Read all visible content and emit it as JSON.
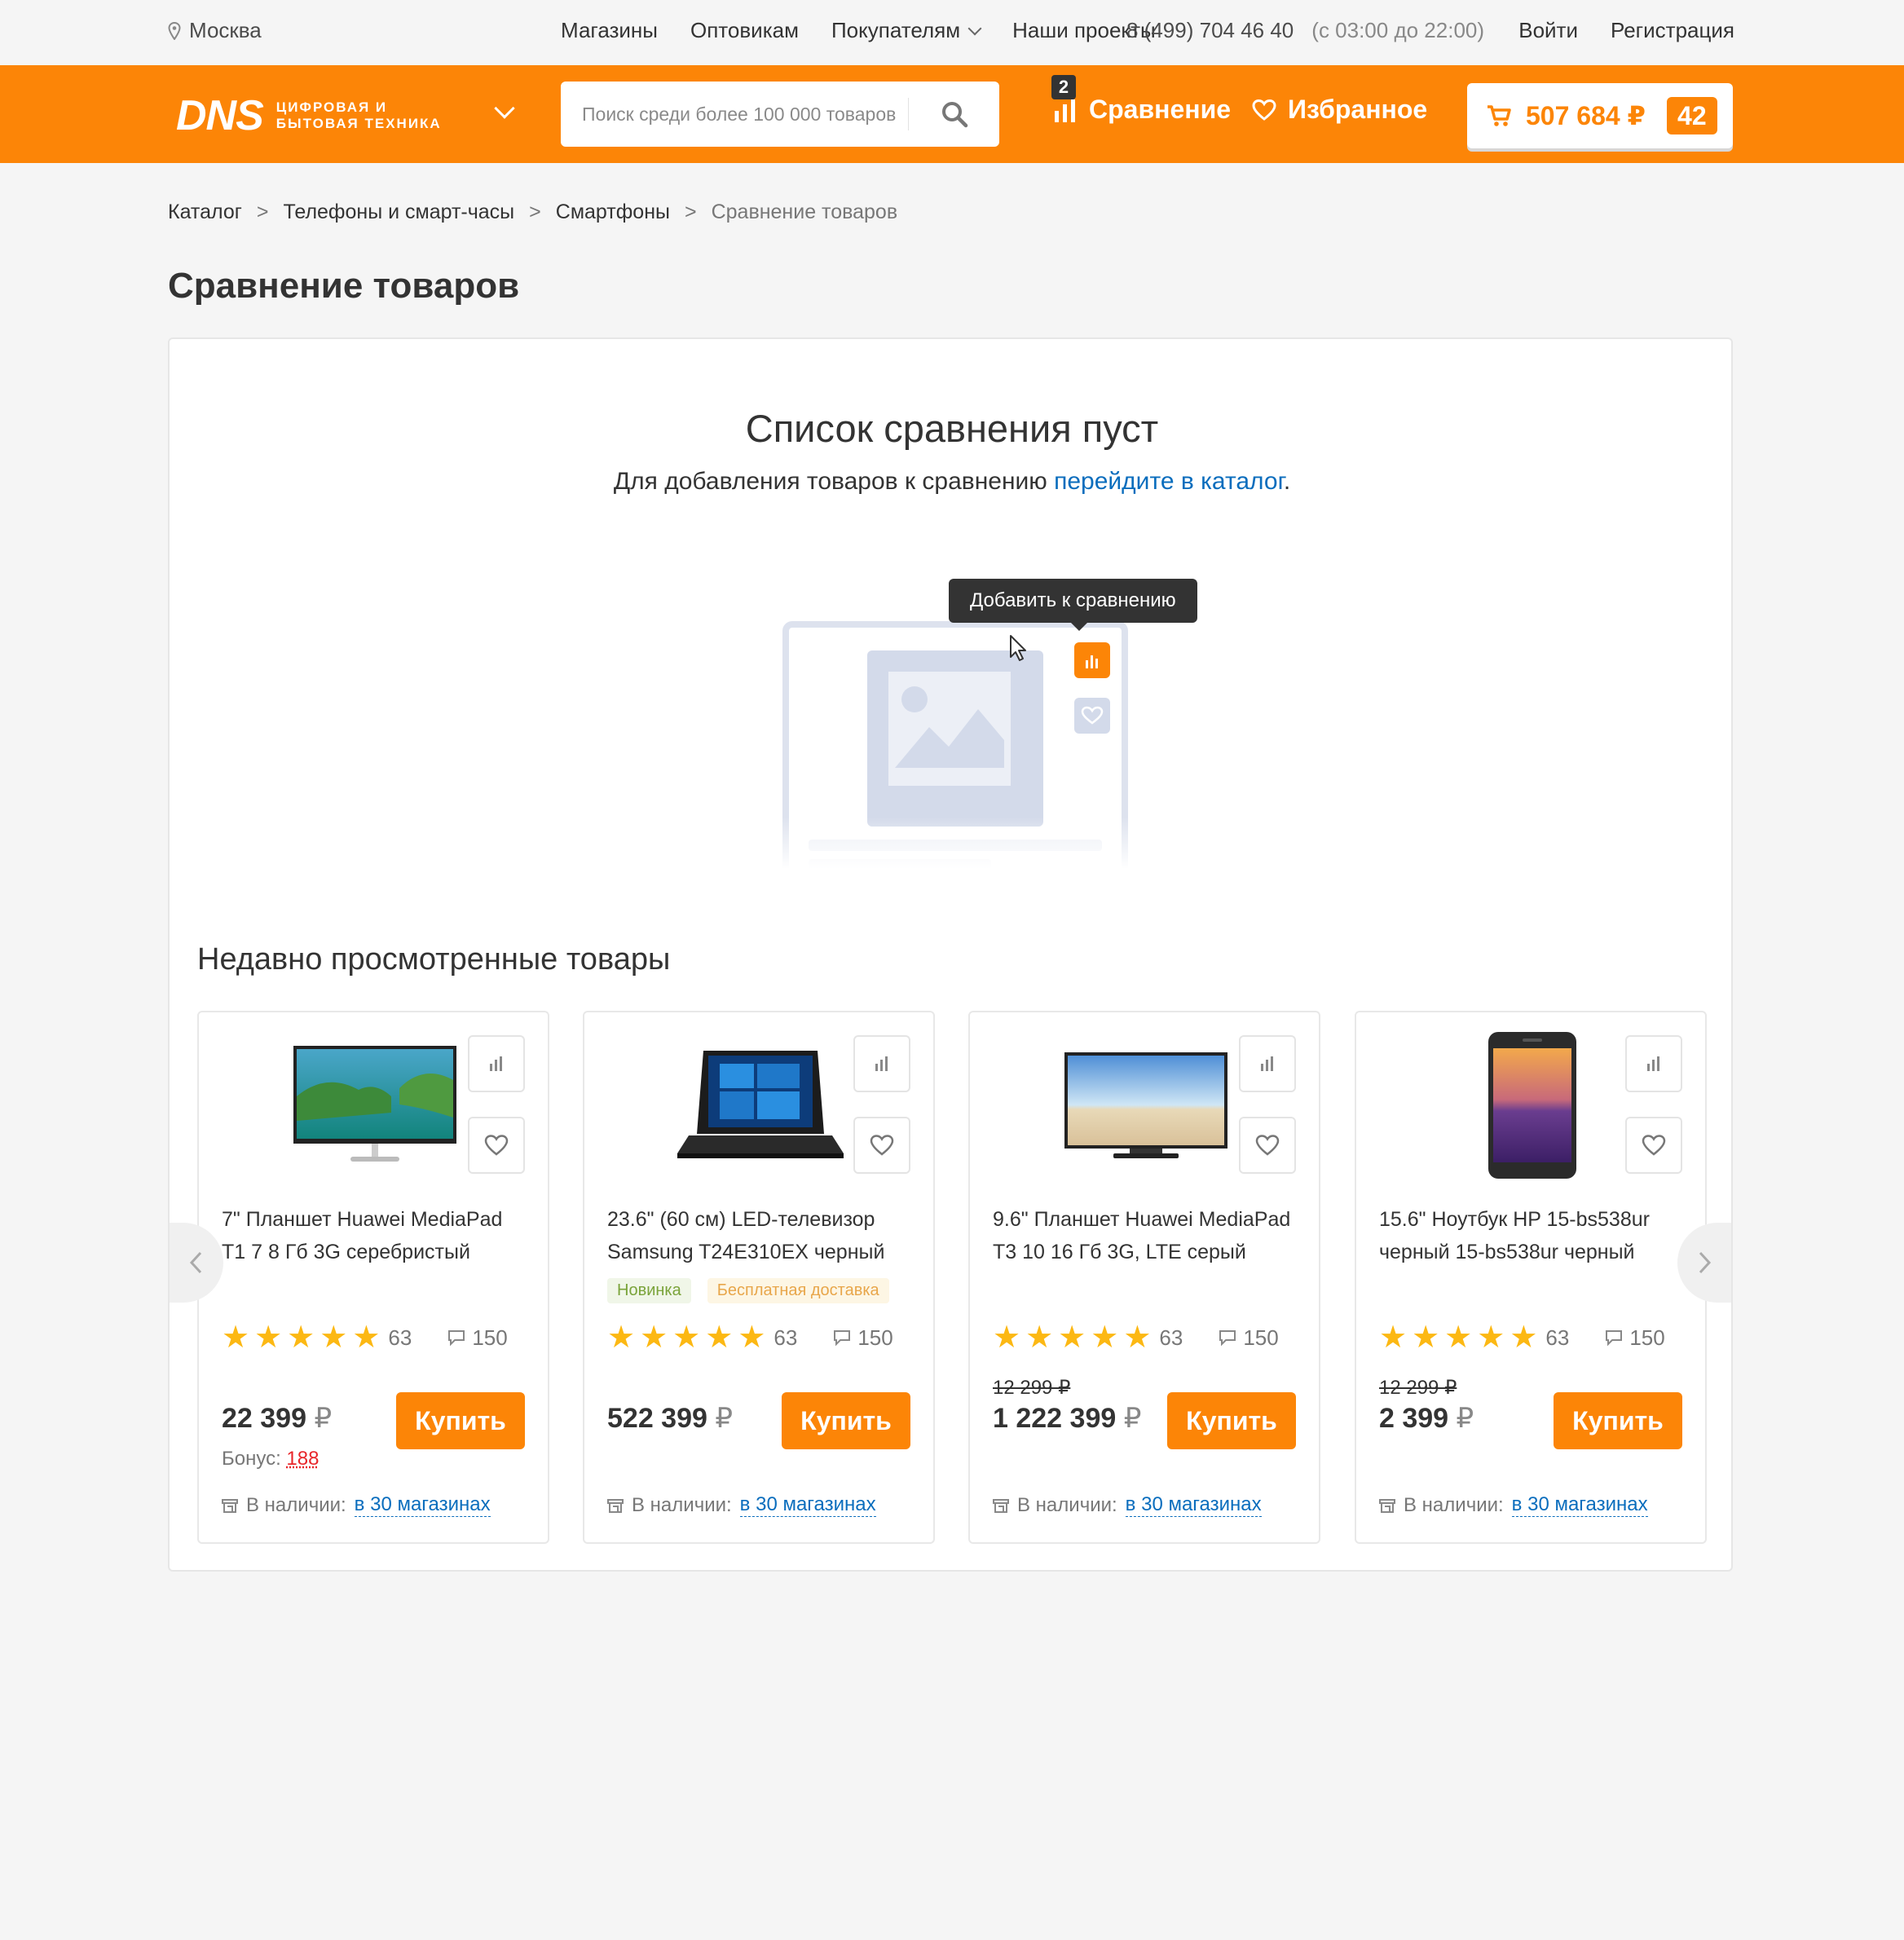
{
  "topbar": {
    "city": "Москва",
    "nav": [
      "Магазины",
      "Оптовикам",
      "Покупателям",
      "Наши проекты"
    ],
    "phone": "8 (499) 704 46 40",
    "hours": "(с 03:00 до 22:00)",
    "login": "Войти",
    "register": "Регистрация"
  },
  "header": {
    "logo_main": "DNS",
    "logo_line1": "цифровая и",
    "logo_line2": "бытовая техника",
    "search_placeholder": "Поиск среди более 100 000 товаров",
    "compare_label": "Сравнение",
    "compare_count": "2",
    "favorites_label": "Избранное",
    "cart_sum": "507 684 ₽",
    "cart_count": "42",
    "accent": "#fc8507"
  },
  "breadcrumb": [
    "Каталог",
    "Телефоны и смарт-часы",
    "Смартфоны",
    "Сравнение товаров"
  ],
  "page_title": "Сравнение товаров",
  "empty": {
    "title": "Список сравнения пуст",
    "text_before": "Для добавления товаров к сравнению ",
    "link": "перейдите в каталог",
    "text_after": ".",
    "tooltip": "Добавить к сравнению"
  },
  "recent": {
    "title": "Недавно просмотренные товары",
    "buy_label": "Купить",
    "avail_label": "В наличии: ",
    "items": [
      {
        "name": "7\" Планшет Huawei MediaPad T1 7 8 Гб 3G серебристый",
        "image": "monitor",
        "badges": [],
        "rating_count": "63",
        "comments": "150",
        "old_price": "",
        "price": "22 399",
        "currency": "₽",
        "bonus_label": "Бонус: ",
        "bonus": "188",
        "availability": "в 30 магазинах"
      },
      {
        "name": "23.6\" (60 см) LED-телевизор Samsung T24E310EX черный",
        "image": "laptop",
        "badges": [
          "Новинка",
          "Бесплатная доставка"
        ],
        "rating_count": "63",
        "comments": "150",
        "old_price": "",
        "price": "522 399",
        "currency": "₽",
        "bonus_label": "",
        "bonus": "",
        "availability": "в 30 магазинах"
      },
      {
        "name": "9.6\" Планшет Huawei MediaPad T3 10 16 Гб 3G, LTE серый",
        "image": "tv",
        "badges": [],
        "rating_count": "63",
        "comments": "150",
        "old_price": "12 299 ₽",
        "price": "1 222 399",
        "currency": "₽",
        "bonus_label": "",
        "bonus": "",
        "availability": "в 30 магазинах"
      },
      {
        "name": "15.6\" Ноутбук HP 15-bs538ur черный 15-bs538ur черный",
        "image": "phone",
        "badges": [],
        "rating_count": "63",
        "comments": "150",
        "old_price": "12 299 ₽",
        "price": "2 399",
        "currency": "₽",
        "bonus_label": "",
        "bonus": "",
        "availability": "в 30 магазинах"
      }
    ]
  }
}
